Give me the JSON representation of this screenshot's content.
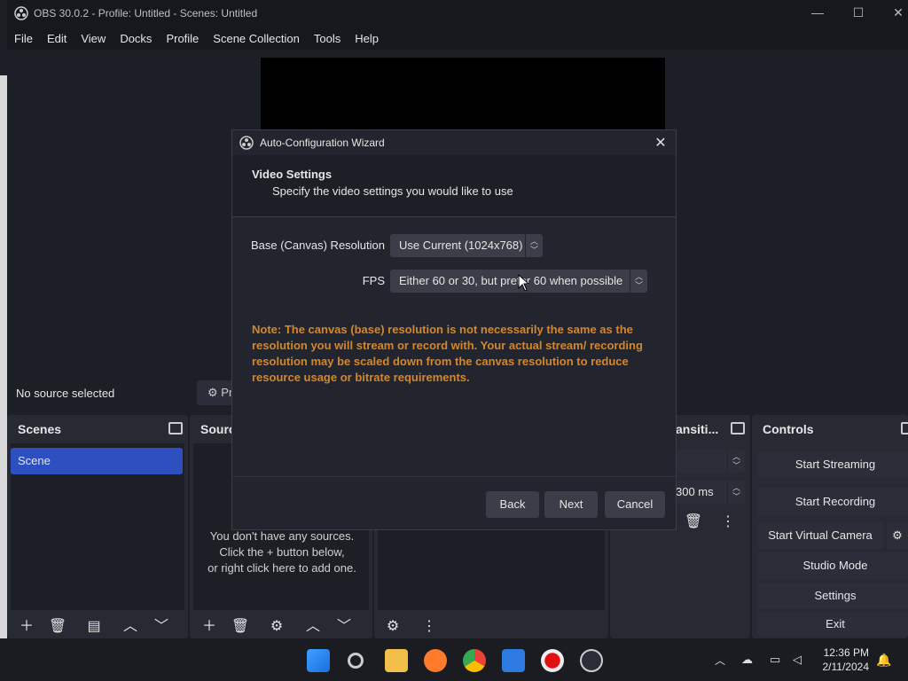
{
  "window": {
    "title": "OBS 30.0.2 - Profile: Untitled - Scenes: Untitled"
  },
  "menu": [
    "File",
    "Edit",
    "View",
    "Docks",
    "Profile",
    "Scene Collection",
    "Tools",
    "Help"
  ],
  "source_bar": {
    "status": "No source selected",
    "properties_label": "Pr"
  },
  "docks": {
    "scenes": {
      "title": "Scenes",
      "items": [
        "Scene"
      ]
    },
    "sources": {
      "title": "Sourc",
      "empty_lines": [
        "You don't have any sources.",
        "Click the + button below,",
        "or right click here to add one."
      ]
    },
    "transitions": {
      "title": "ansiti...",
      "duration": "300 ms"
    },
    "controls": {
      "title": "Controls",
      "buttons": [
        "Start Streaming",
        "Start Recording",
        "Start Virtual Camera",
        "Studio Mode",
        "Settings",
        "Exit"
      ]
    }
  },
  "dialog": {
    "title": "Auto-Configuration Wizard",
    "header_title": "Video Settings",
    "header_subtitle": "Specify the video settings you would like to use",
    "resolution_label": "Base (Canvas) Resolution",
    "resolution_value": "Use Current (1024x768)",
    "fps_label": "FPS",
    "fps_value": "Either 60 or 30, but prefer 60 when possible",
    "note": "Note: The canvas (base) resolution is not necessarily the same as the resolution you will stream or record with. Your actual stream/ recording resolution may be scaled down from the canvas resolution to reduce resource usage or bitrate requirements.",
    "buttons": {
      "back": "Back",
      "next": "Next",
      "cancel": "Cancel"
    },
    "note_color": "#d6862a"
  },
  "taskbar": {
    "time": "12:36 PM",
    "date": "2/11/2024"
  },
  "colors": {
    "accent": "#2e4fbf",
    "background": "#1d1f26"
  }
}
